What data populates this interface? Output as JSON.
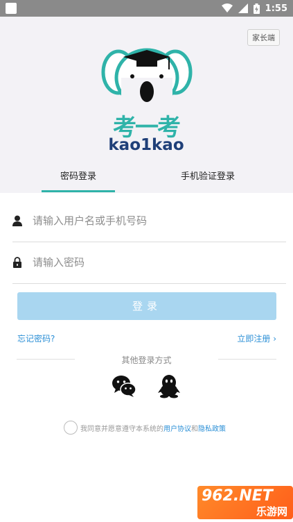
{
  "status_bar": {
    "time": "1:55"
  },
  "header": {
    "parent_button": "家长端",
    "brand_cn": "考一考",
    "brand_en": "kao1kao"
  },
  "tabs": [
    {
      "label": "密码登录",
      "active": true
    },
    {
      "label": "手机验证登录",
      "active": false
    }
  ],
  "form": {
    "username_placeholder": "请输入用户名或手机号码",
    "password_placeholder": "请输入密码",
    "login_label": "登录",
    "forgot_label": "忘记密码?",
    "register_label": "立即注册 ›"
  },
  "other_login": {
    "label": "其他登录方式",
    "methods": [
      "wechat-icon",
      "qq-icon"
    ]
  },
  "agreement": {
    "prefix": "我同意并愿意遵守本系统的",
    "link1": "用户协议",
    "conj": "和",
    "link2": "隐私政策"
  },
  "watermark": {
    "top": "962.NET",
    "bottom": "乐游网"
  },
  "colors": {
    "accent": "#2fb3a9",
    "brand_dark": "#1f3f78",
    "link": "#2b8fd6",
    "button_disabled": "#a9d6f0"
  }
}
